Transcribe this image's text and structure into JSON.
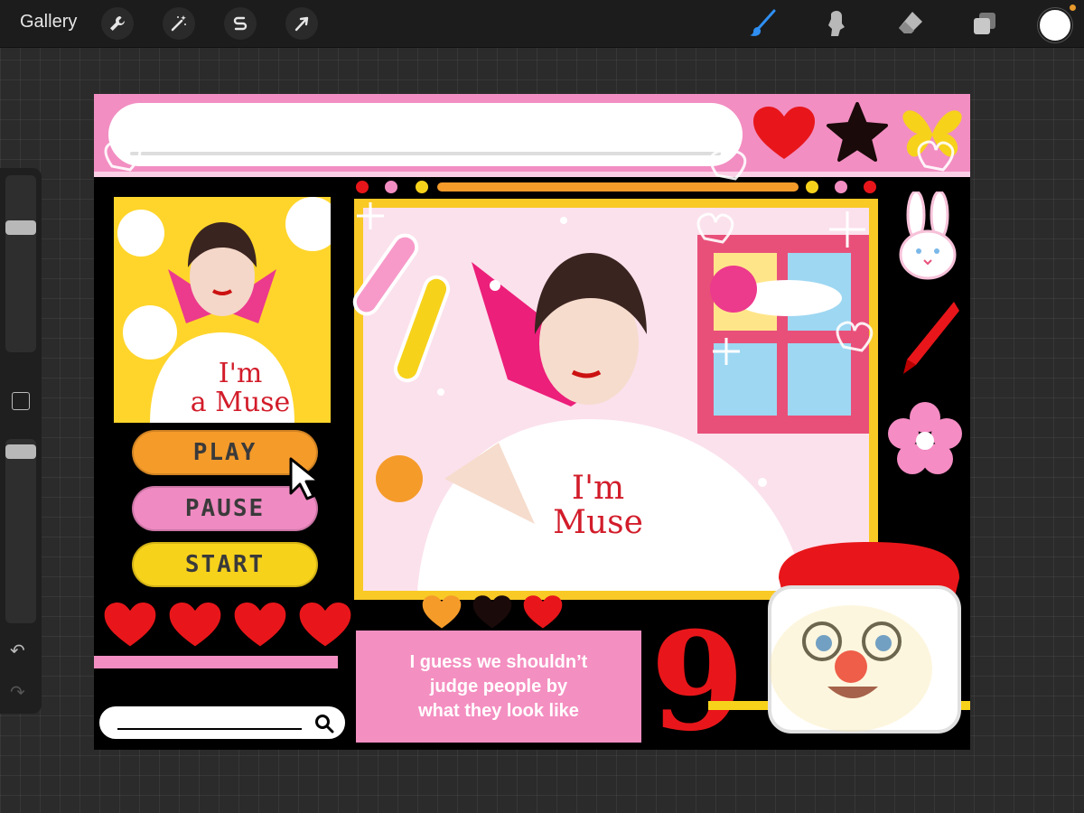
{
  "topbar": {
    "gallery_label": "Gallery",
    "left_tools": [
      "wrench-icon",
      "magic-wand-icon",
      "selection-icon",
      "transform-arrow-icon"
    ],
    "right_tools": [
      "brush-icon",
      "smudge-icon",
      "eraser-icon",
      "layers-icon"
    ],
    "active_tool": "brush-icon",
    "current_color": "#ffffff"
  },
  "sidebar": {
    "brush_size_level": 0.72,
    "opacity_level": 0.04
  },
  "artwork": {
    "accent_colors": {
      "pink": "#f28ec2",
      "orange": "#f59b2a",
      "yellow": "#f9c926",
      "red": "#e8161a"
    },
    "buttons": {
      "play": "PLAY",
      "pause": "PAUSE",
      "start": "START"
    },
    "quote": "I guess we shouldn’t\njudge people by\nwhat they look like",
    "shirt_text_small": "I'm\na Muse",
    "shirt_text_big": "I'm\nMuse",
    "big_number": "9",
    "lives_hearts": 4
  }
}
